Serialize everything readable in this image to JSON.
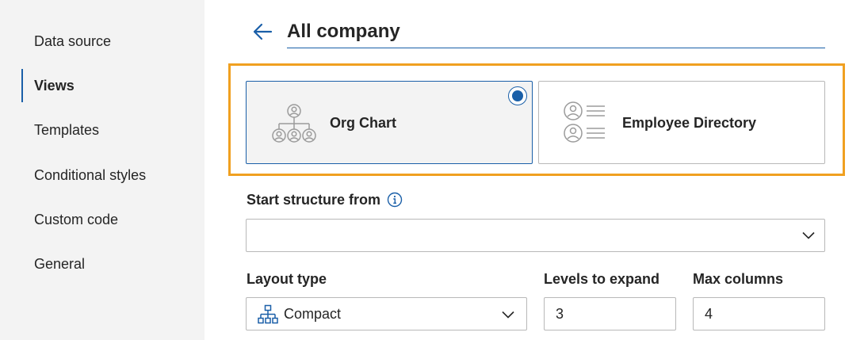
{
  "sidebar": {
    "items": [
      {
        "label": "Data source",
        "active": false
      },
      {
        "label": "Views",
        "active": true
      },
      {
        "label": "Templates",
        "active": false
      },
      {
        "label": "Conditional styles",
        "active": false
      },
      {
        "label": "Custom code",
        "active": false
      },
      {
        "label": "General",
        "active": false
      }
    ]
  },
  "header": {
    "title": "All company",
    "back_icon": "arrow-left-icon"
  },
  "views": {
    "selected": "Org Chart",
    "options": [
      {
        "label": "Org Chart",
        "icon": "org-chart-icon",
        "selected": true
      },
      {
        "label": "Employee Directory",
        "icon": "directory-icon",
        "selected": false
      }
    ]
  },
  "start_structure": {
    "label": "Start structure from",
    "value": "",
    "info_icon": "info-icon"
  },
  "layout_type": {
    "label": "Layout type",
    "value": "Compact",
    "icon": "hierarchy-icon"
  },
  "levels_to_expand": {
    "label": "Levels to expand",
    "value": "3"
  },
  "max_columns": {
    "label": "Max columns",
    "value": "4"
  },
  "colors": {
    "accent": "#1a5fa8",
    "highlight": "#f0a020",
    "sidebar_bg": "#f3f3f3"
  }
}
